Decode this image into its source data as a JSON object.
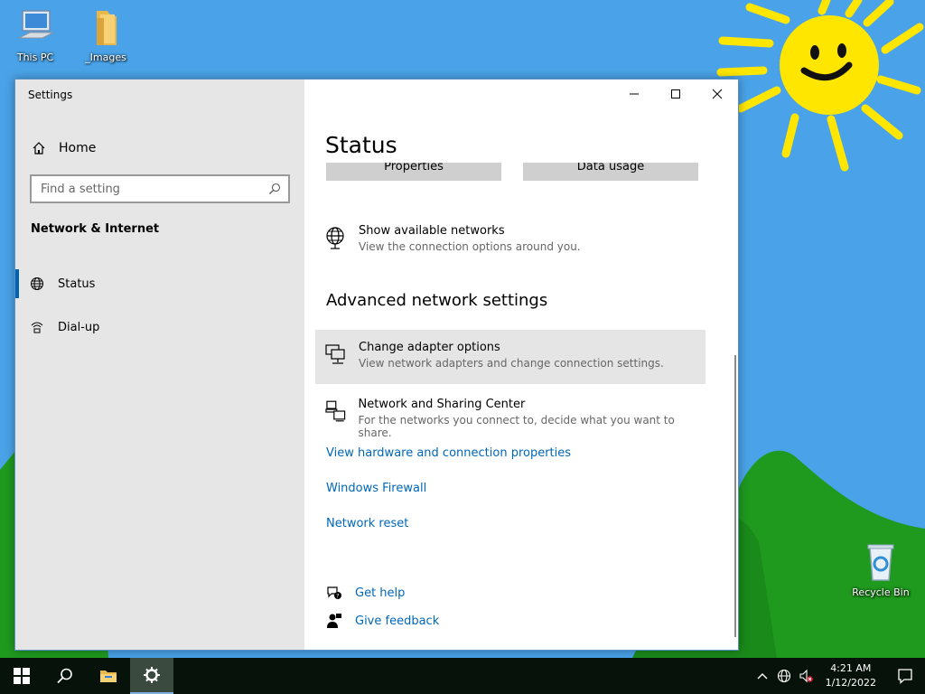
{
  "desktop": {
    "icons": [
      {
        "label": "This PC"
      },
      {
        "label": "_Images"
      },
      {
        "label": "Recycle Bin"
      }
    ]
  },
  "window": {
    "app_title": "Settings",
    "controls": {
      "minimize": "minimize-icon",
      "maximize": "maximize-icon",
      "close": "close-icon"
    }
  },
  "sidebar": {
    "home_label": "Home",
    "search_placeholder": "Find a setting",
    "section": "Network & Internet",
    "items": [
      {
        "label": "Status",
        "icon": "globe-icon",
        "selected": true
      },
      {
        "label": "Dial-up",
        "icon": "dialup-icon",
        "selected": false
      }
    ]
  },
  "main": {
    "title": "Status",
    "top_buttons": [
      "Properties",
      "Data usage"
    ],
    "show_networks": {
      "title": "Show available networks",
      "desc": "View the connection options around you."
    },
    "advanced_heading": "Advanced network settings",
    "adapter": {
      "title": "Change adapter options",
      "desc": "View network adapters and change connection settings."
    },
    "sharing": {
      "title": "Network and Sharing Center",
      "desc": "For the networks you connect to, decide what you want to share."
    },
    "links": [
      "View hardware and connection properties",
      "Windows Firewall",
      "Network reset"
    ],
    "help": {
      "get_help": "Get help",
      "feedback": "Give feedback"
    }
  },
  "taskbar": {
    "time": "4:21 AM",
    "date": "1/12/2022"
  },
  "colors": {
    "accent": "#0063b1",
    "link": "#0067b8",
    "sidebar_bg": "#e6e6e6",
    "sky": "#4aa3e8",
    "grass": "#1f9a1f",
    "sun": "#ffe600"
  }
}
